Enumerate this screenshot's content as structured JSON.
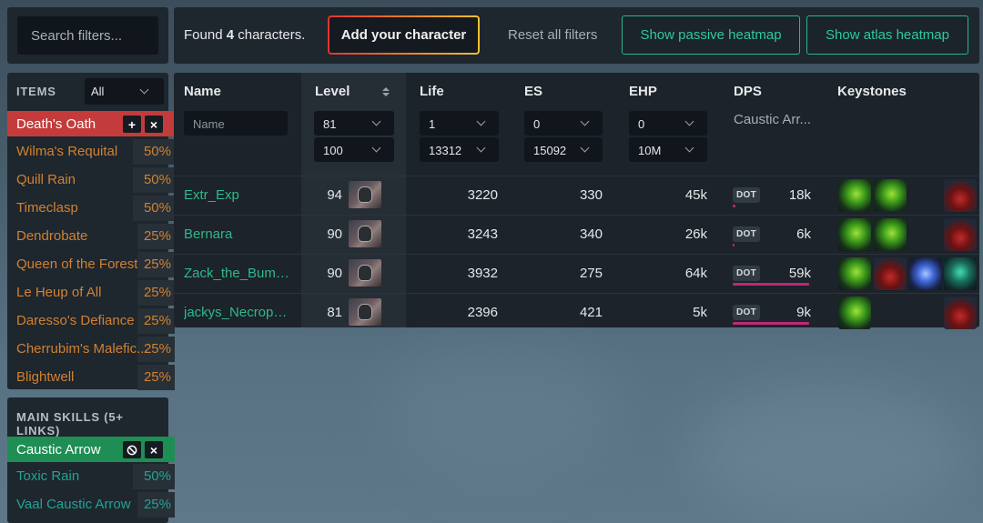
{
  "search": {
    "placeholder": "Search filters..."
  },
  "topbar": {
    "found_prefix": "Found",
    "found_count": "4",
    "found_suffix": "characters.",
    "add_character": "Add your character",
    "reset_filters": "Reset all filters",
    "passive_heatmap": "Show passive heatmap",
    "atlas_heatmap": "Show atlas heatmap",
    "colors": {
      "accent_green": "#2fc99b",
      "add_border_start": "#e0352f",
      "add_border_end": "#f2c12e"
    }
  },
  "items_panel": {
    "title": "ITEMS",
    "filter_value": "All",
    "active_item": "Death's Oath",
    "active_color": "#c43b3b",
    "items": [
      {
        "name": "Wilma's Requital",
        "pct": "50%",
        "share": 0.5
      },
      {
        "name": "Quill Rain",
        "pct": "50%",
        "share": 0.5
      },
      {
        "name": "Timeclasp",
        "pct": "50%",
        "share": 0.5
      },
      {
        "name": "Dendrobate",
        "pct": "25%",
        "share": 0.25
      },
      {
        "name": "Queen of the Forest",
        "pct": "25%",
        "share": 0.25
      },
      {
        "name": "Le Heup of All",
        "pct": "25%",
        "share": 0.25
      },
      {
        "name": "Daresso's Defiance",
        "pct": "25%",
        "share": 0.25
      },
      {
        "name": "Cherrubim's Malefic...",
        "pct": "25%",
        "share": 0.25
      },
      {
        "name": "Blightwell",
        "pct": "25%",
        "share": 0.25
      }
    ]
  },
  "skills_panel": {
    "title": "MAIN SKILLS (5+ LINKS)",
    "active_skill": "Caustic Arrow",
    "active_color": "#1f8e54",
    "skills": [
      {
        "name": "Toxic Rain",
        "pct": "50%",
        "share": 0.5
      },
      {
        "name": "Vaal Caustic Arrow",
        "pct": "25%",
        "share": 0.25
      }
    ]
  },
  "table": {
    "headers": {
      "name": "Name",
      "level": "Level",
      "life": "Life",
      "es": "ES",
      "ehp": "EHP",
      "dps": "DPS",
      "keystones": "Keystones"
    },
    "filters": {
      "name_placeholder": "Name",
      "level_min": "81",
      "level_max": "100",
      "life_min": "1",
      "life_max": "13312",
      "es_min": "0",
      "es_max": "15092",
      "ehp_min": "0",
      "ehp_max": "10M",
      "dps_skill": "Caustic Arr..."
    },
    "rows": [
      {
        "name": "Extr_Exp",
        "level": "94",
        "life": "3220",
        "es": "330",
        "ehp": "45k",
        "dps_type": "DOT",
        "dps": "18k",
        "dps_share": 0.03,
        "keystones": [
          "green-gem",
          "green-gem"
        ],
        "right_keystone": "red-keystone"
      },
      {
        "name": "Bernara",
        "level": "90",
        "life": "3243",
        "es": "340",
        "ehp": "26k",
        "dps_type": "DOT",
        "dps": "6k",
        "dps_share": 0.01,
        "keystones": [
          "green-gem",
          "green-gem"
        ],
        "right_keystone": "red-keystone"
      },
      {
        "name": "Zack_the_Bumb...",
        "level": "90",
        "life": "3932",
        "es": "275",
        "ehp": "64k",
        "dps_type": "DOT",
        "dps": "59k",
        "dps_share": 1.0,
        "keystones": [
          "green-gem",
          "red-keystone",
          "blue-orb"
        ],
        "right_keystone": "teal-keystone"
      },
      {
        "name": "jackys_Necropol...",
        "level": "81",
        "life": "2396",
        "es": "421",
        "ehp": "5k",
        "dps_type": "DOT",
        "dps": "9k",
        "dps_share": 1.0,
        "keystones": [
          "green-gem"
        ],
        "right_keystone": "red-keystone"
      }
    ]
  }
}
